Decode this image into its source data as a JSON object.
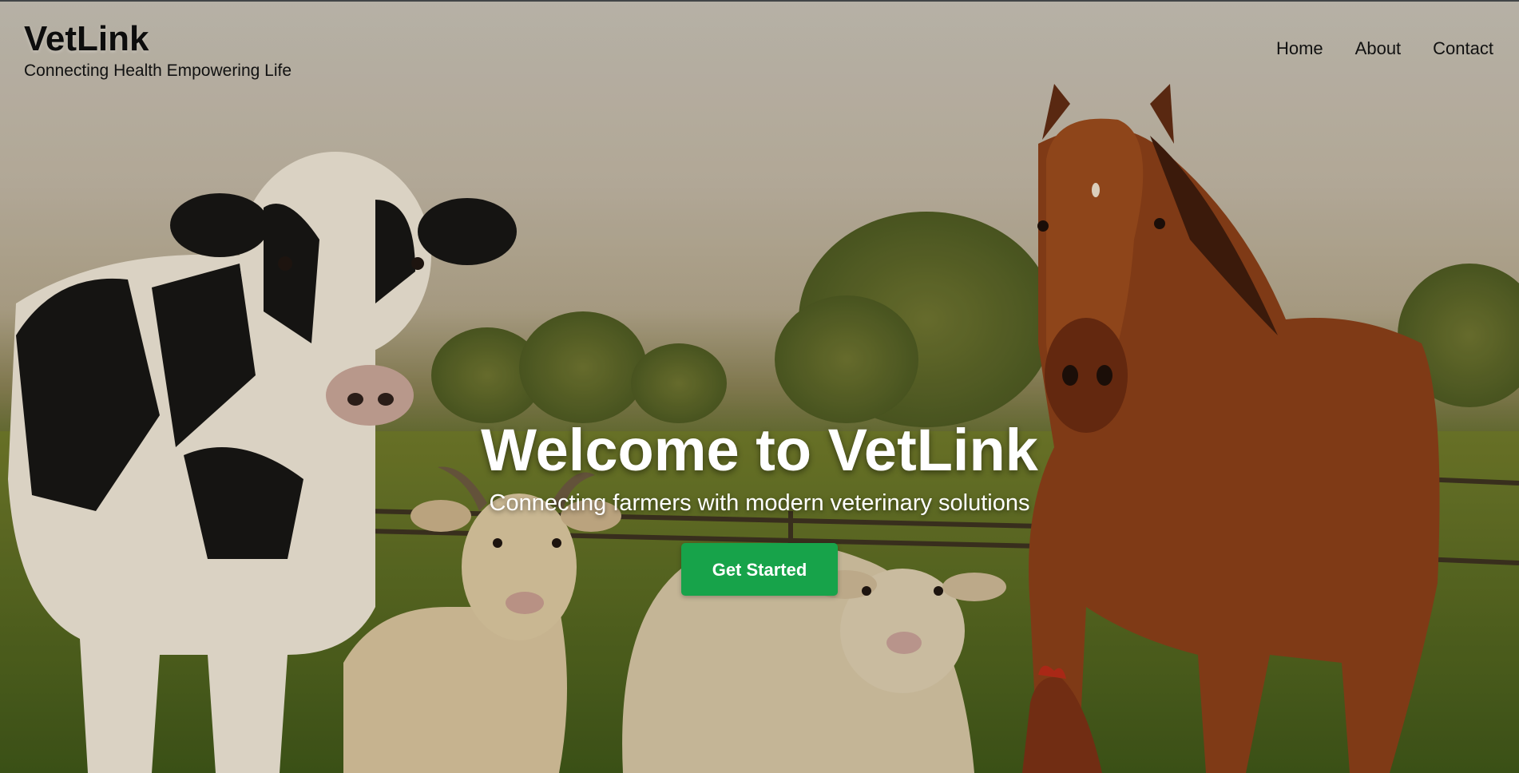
{
  "brand": {
    "name": "VetLink",
    "tagline": "Connecting Health Empowering Life"
  },
  "nav": {
    "items": [
      {
        "label": "Home"
      },
      {
        "label": "About"
      },
      {
        "label": "Contact"
      }
    ]
  },
  "hero": {
    "title": "Welcome to VetLink",
    "subtitle": "Connecting farmers with modern veterinary solutions",
    "cta_label": "Get Started"
  },
  "background": {
    "subject": "farm-animals-in-pasture",
    "animals": [
      "cow",
      "goat",
      "sheep",
      "horse",
      "chicken"
    ]
  },
  "colors": {
    "accent": "#17a34a",
    "hero_text": "#ffffff",
    "header_text": "#111111"
  }
}
